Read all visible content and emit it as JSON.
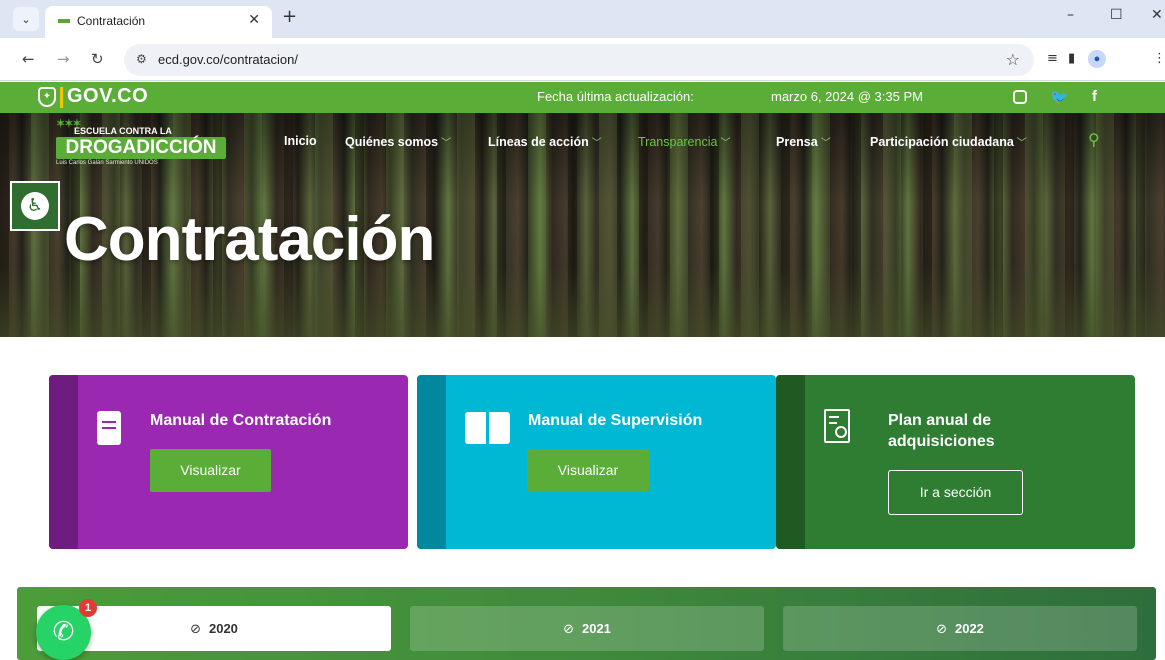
{
  "browser": {
    "tab_title": "Contratación",
    "url": "ecd.gov.co/contratacion/",
    "icons": [
      "tab-dropdown-icon",
      "close-icon",
      "plus-icon",
      "minimize-icon",
      "maximize-icon",
      "close-window-icon",
      "back-icon",
      "forward-icon",
      "reload-icon",
      "site-settings-icon",
      "star-icon",
      "reading-list-icon",
      "sidebar-icon",
      "profile-icon",
      "menu-icon"
    ]
  },
  "govbar": {
    "logo": "GOV.CO",
    "update_label": "Fecha última actualización:",
    "update_date": "marzo 6, 2024 @ 3:35 PM",
    "social": [
      "instagram-icon",
      "twitter-icon",
      "facebook-icon"
    ]
  },
  "brand": {
    "top": "ESCUELA CONTRA LA",
    "main": "DROGADICCIÓN",
    "sub": "Luis Carlos Galán Sarmiento UNIDOS"
  },
  "nav": {
    "items": [
      {
        "label": "Inicio"
      },
      {
        "label": "Quiénes somos"
      },
      {
        "label": "Líneas de acción"
      },
      {
        "label": "Transparencia"
      },
      {
        "label": "Prensa"
      },
      {
        "label": "Participación ciudadana"
      }
    ]
  },
  "hero": {
    "title": "Contratación"
  },
  "cards": [
    {
      "title": "Manual de Contratación",
      "button": "Visualizar",
      "color": "#9b28b0",
      "stripe": "#6f1c80"
    },
    {
      "title": "Manual de Supervisión",
      "button": "Visualizar",
      "color": "#00b8d4",
      "stripe": "#00899e"
    },
    {
      "title": "Plan anual de adquisiciones",
      "title_line1": "Plan anual de",
      "title_line2": "adquisiciones",
      "button": "Ir a sección",
      "color": "#2e7d32",
      "stripe": "#1f5a23"
    }
  ],
  "years": {
    "items": [
      {
        "label": "2020",
        "active": true
      },
      {
        "label": "2021",
        "active": false
      },
      {
        "label": "2022",
        "active": false
      }
    ]
  },
  "whatsapp": {
    "badge": "1"
  },
  "colors": {
    "gov_green": "#5aad36",
    "accent_green": "#6cc644"
  }
}
